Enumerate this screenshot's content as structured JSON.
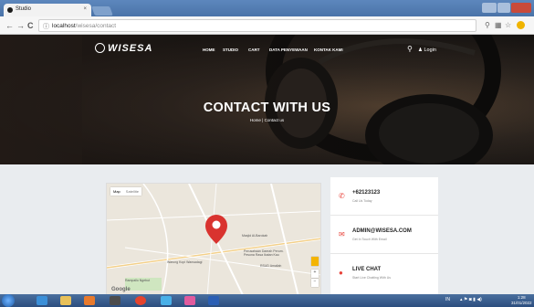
{
  "browser": {
    "tab_title": "Studio",
    "tab_close": "×",
    "url_host": "localhost",
    "url_path": "/wisesa/contact",
    "back": "←",
    "forward": "→",
    "reload": "C",
    "info": "ⓘ"
  },
  "site": {
    "logo": "WISESA",
    "menu": [
      "HOME",
      "STUDIO",
      "CART",
      "DATA PENYEWAAN",
      "KONTAK KAMI"
    ],
    "login": "Login",
    "hero_title": "CONTACT WITH US",
    "breadcrumb_home": "Home",
    "breadcrumb_sep": "|",
    "breadcrumb_current": "Contact us"
  },
  "map": {
    "tabs": [
      "Map",
      "Satellite"
    ],
    "labels": [
      "Masjid Al-Barokah",
      "Perusahaan Daerah Perum. Pesona Rasa Ikatan Kau",
      "RSUD Amaliah",
      "Warung Kopi Wansadagi",
      "Rampallo Ngebut"
    ],
    "zoom_in": "+",
    "zoom_out": "−",
    "provider": "Google"
  },
  "contact": [
    {
      "icon": "phone-icon",
      "title": "+62123123",
      "sub": "Call Us Today"
    },
    {
      "icon": "mail-icon",
      "title": "ADMIN@WISESA.COM",
      "sub": "Get In Touch With Email"
    },
    {
      "icon": "chat-icon",
      "title": "LIVE CHAT",
      "sub": "Start Live Chatting With Us"
    }
  ],
  "taskbar": {
    "tray_lang": "IN",
    "time": "1:28",
    "date": "31/01/2022"
  },
  "colors": {
    "accent": "#e8433a",
    "titlebar": "#4a73a8",
    "taskbar": "#2c4e7f"
  }
}
